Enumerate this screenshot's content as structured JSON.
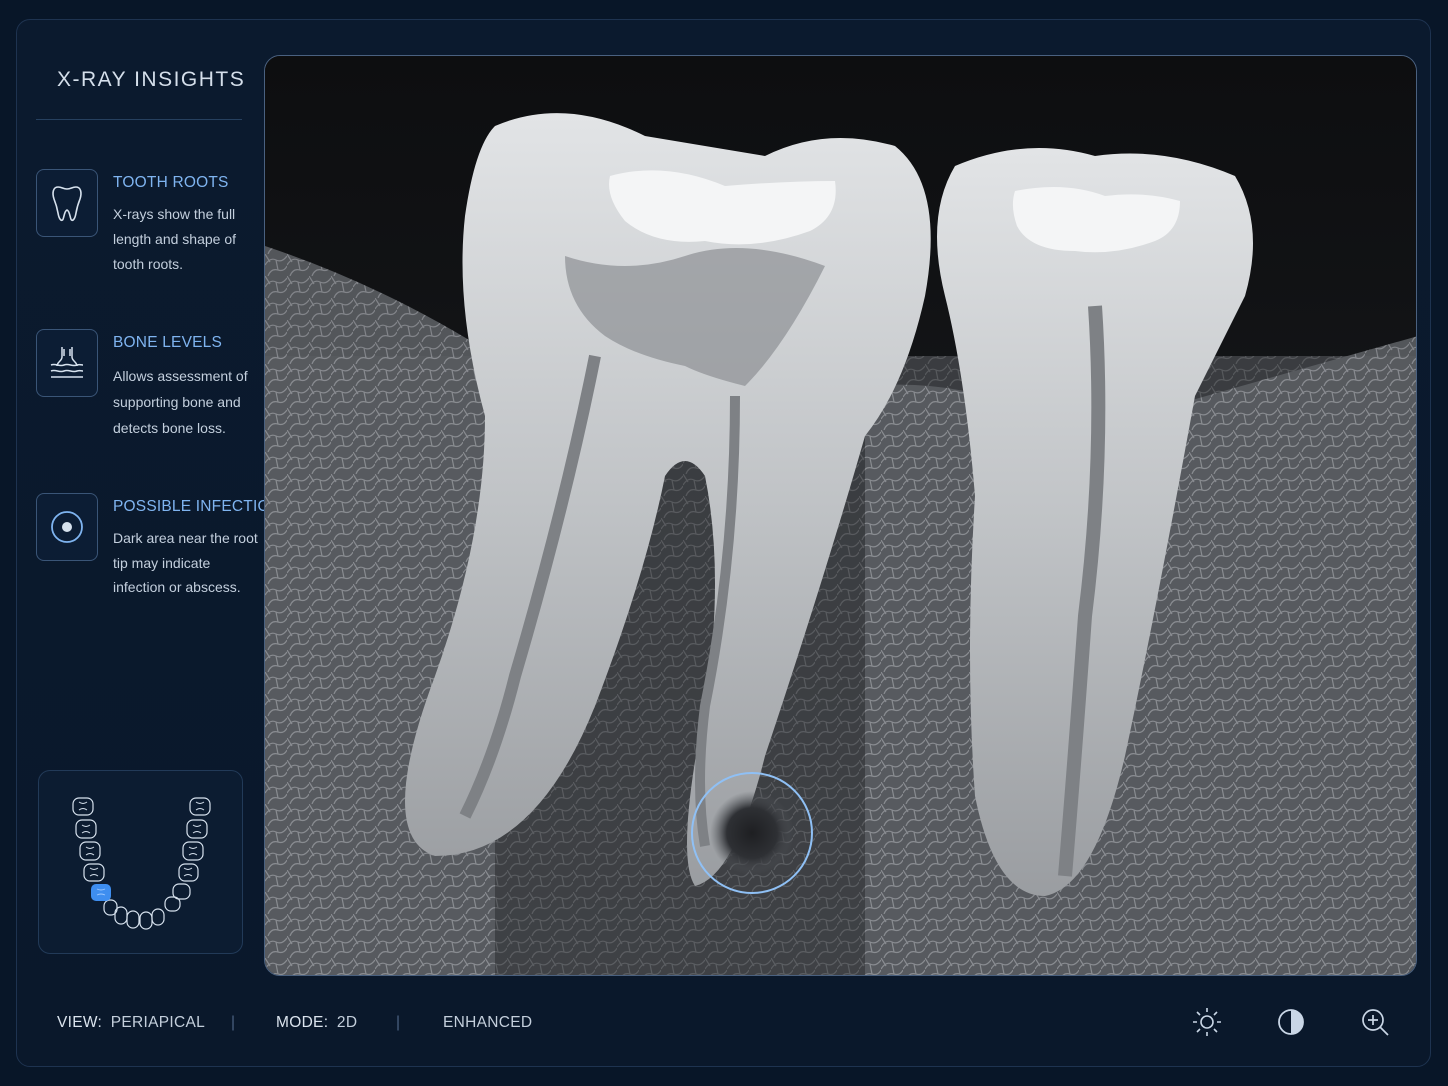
{
  "sidebar": {
    "title": "X-RAY INSIGHTS",
    "items": [
      {
        "icon": "tooth-icon",
        "title": "TOOTH ROOTS",
        "desc": "X-rays show the full length and shape of tooth roots."
      },
      {
        "icon": "bone-level-icon",
        "title": "BONE LEVELS",
        "desc": "Allows assessment of supporting bone and detects bone loss."
      },
      {
        "icon": "target-icon",
        "title": "POSSIBLE INFECTION",
        "desc": "Dark area near the root tip may indicate infection or abscess."
      }
    ],
    "jaw_map": {
      "selected_tooth": "lower-left molar",
      "highlight_color": "#3e8ef0"
    }
  },
  "viewer": {
    "image": "periapical dental x-ray of two lower molars",
    "annotation": {
      "type": "circle",
      "meaning": "periapical lesion",
      "color": "#8fc0f5"
    }
  },
  "footer": {
    "view_label": "VIEW:",
    "view_value": "PERIAPICAL",
    "mode_label": "MODE:",
    "mode_value": "2D",
    "enhanced": "ENHANCED",
    "separator": "|",
    "tools": [
      "brightness-icon",
      "contrast-icon",
      "zoom-in-icon"
    ]
  },
  "colors": {
    "background": "#081628",
    "accent": "#7fb4f0",
    "border": "#3a5577"
  }
}
